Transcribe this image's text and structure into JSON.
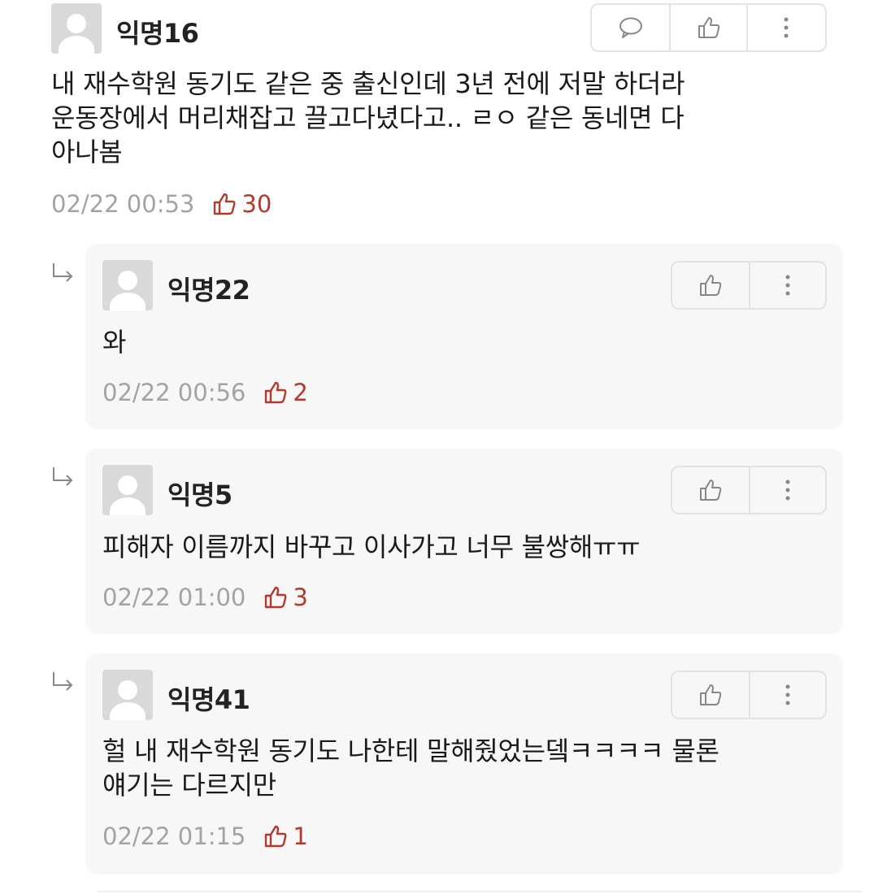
{
  "colors": {
    "like_accent": "#b03a2e",
    "meta_gray": "#a3a3a3",
    "reply_bg": "#f7f7f7",
    "border": "#e3e3e3"
  },
  "comment": {
    "author": "익명16",
    "lines": [
      "내 재수학원 동기도 같은 중 출신인데 3년 전에 저말 하더라",
      "운동장에서 머리채잡고 끌고다녔다고.. ㄹㅇ 같은 동네면 다",
      "아나봄"
    ],
    "timestamp": "02/22 00:53",
    "likes": "30",
    "icons": [
      "reply-bubble-icon",
      "thumbs-up-icon",
      "more-vertical-icon"
    ]
  },
  "replies": [
    {
      "author": "익명22",
      "lines": [
        "와"
      ],
      "timestamp": "02/22 00:56",
      "likes": "2"
    },
    {
      "author": "익명5",
      "lines": [
        "피해자 이름까지 바꾸고 이사가고 너무 불쌍해ㅠㅠ"
      ],
      "timestamp": "02/22 01:00",
      "likes": "3"
    },
    {
      "author": "익명41",
      "lines": [
        "헐 내 재수학원 동기도 나한테 말해줬었는뎈ㅋㅋㅋㅋ 물론",
        "얘기는 다르지만"
      ],
      "timestamp": "02/22 01:15",
      "likes": "1"
    }
  ]
}
